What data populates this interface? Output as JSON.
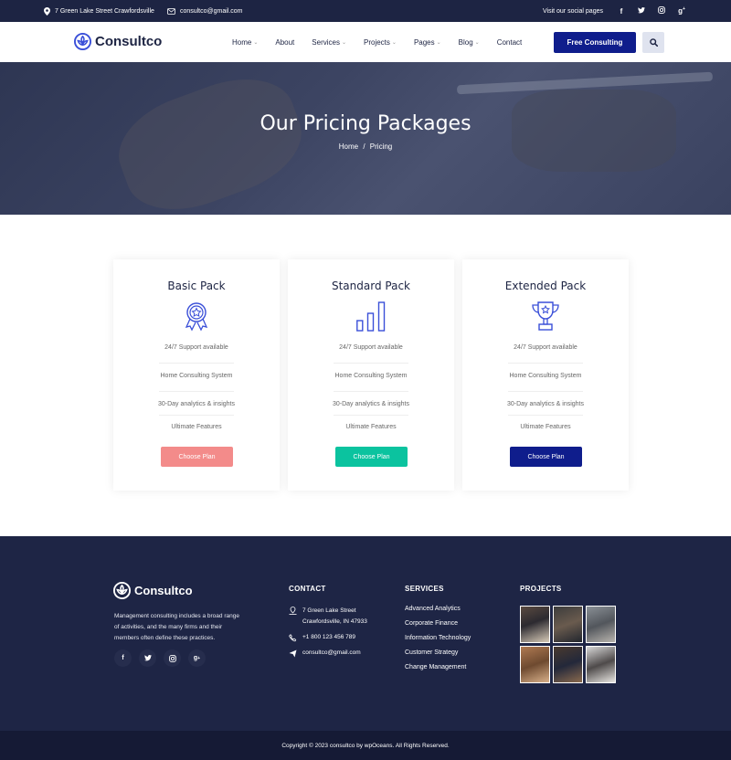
{
  "topbar": {
    "address": "7 Green Lake Street Crawfordsville",
    "email": "consultco@gmail.com",
    "social_text": "Visit our social pages",
    "icons": [
      "location-icon",
      "mail-icon",
      "facebook-icon",
      "twitter-icon",
      "instagram-icon",
      "google-plus-icon"
    ]
  },
  "header": {
    "brand": "Consultco",
    "nav": [
      {
        "label": "Home",
        "dropdown": true
      },
      {
        "label": "About",
        "dropdown": false
      },
      {
        "label": "Services",
        "dropdown": true
      },
      {
        "label": "Projects",
        "dropdown": true
      },
      {
        "label": "Pages",
        "dropdown": true
      },
      {
        "label": "Blog",
        "dropdown": true
      },
      {
        "label": "Contact",
        "dropdown": false
      }
    ],
    "cta": "Free Consulting"
  },
  "hero": {
    "title": "Our Pricing Packages",
    "breadcrumb_home": "Home",
    "breadcrumb_sep": "/",
    "breadcrumb_current": "Pricing"
  },
  "pricing": [
    {
      "name": "Basic Pack",
      "icon": "award-icon",
      "features": [
        "24/7 Support available",
        "Home Consulting System",
        "30-Day analytics & insights",
        "Ultimate Features"
      ],
      "button": "Choose Plan",
      "button_color": "#f38b8a"
    },
    {
      "name": "Standard Pack",
      "icon": "bar-chart-icon",
      "features": [
        "24/7 Support available",
        "Home Consulting System",
        "30-Day analytics & insights",
        "Ultimate Features"
      ],
      "button": "Choose Plan",
      "button_color": "#0bc39f"
    },
    {
      "name": "Extended Pack",
      "icon": "trophy-icon",
      "features": [
        "24/7 Support available",
        "Home Consulting System",
        "30-Day analytics & insights",
        "Ultimate Features"
      ],
      "button": "Choose Plan",
      "button_color": "#0f1d8c"
    }
  ],
  "footer": {
    "brand": "Consultco",
    "description": "Management consulting includes a broad range of activities, and the many firms and their members often define these practices.",
    "contact_title": "CONTACT",
    "address_line1": "7 Green Lake Street",
    "address_line2": "Crawfordsville, IN 47933",
    "phone": "+1 800 123 456 789",
    "email": "consultco@gmail.com",
    "services_title": "SERVICES",
    "services": [
      "Advanced Analytics",
      "Corporate Finance",
      "Information Technology",
      "Customer Strategy",
      "Change Management"
    ],
    "projects_title": "PROJECTS",
    "copyright": "Copyright © 2023 consultco by wpOceans. All Rights Reserved."
  },
  "colors": {
    "navy": "#1d2443",
    "brand_blue": "#0f1d8c",
    "accent_blue": "#3a4fd8",
    "coral": "#f38b8a",
    "teal": "#0bc39f"
  }
}
